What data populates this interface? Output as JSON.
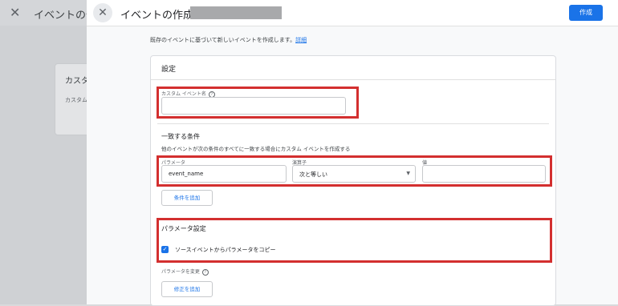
{
  "background": {
    "close_glyph": "✕",
    "title": "イベントの作",
    "card_title": "カスタム",
    "card_sub": "カスタム"
  },
  "modal": {
    "close_glyph": "✕",
    "title": "イベントの作成",
    "create_button": "作成",
    "intro_text": "既存のイベントに基づいて新しいイベントを作成します。",
    "intro_link": "詳細"
  },
  "settings": {
    "title": "設定",
    "custom_event_name_label": "カスタム イベント名",
    "custom_event_name_value": "",
    "conditions": {
      "title": "一致する条件",
      "description": "他のイベントが次の条件のすべてに一致する場合にカスタム イベントを作成する",
      "parameter_label": "パラメータ",
      "parameter_value": "event_name",
      "operator_label": "演算子",
      "operator_value": "次と等しい",
      "value_label": "値",
      "value_value": "",
      "add_condition_button": "条件を追加"
    },
    "parameter_settings": {
      "title": "パラメータ設定",
      "copy_checkbox_label": "ソースイベントからパラメータをコピー",
      "copy_checked": true
    },
    "modify_params_label": "パラメータを変更",
    "add_modification_button": "修正を追加"
  },
  "colors": {
    "accent": "#1a73e8",
    "highlight": "#d32f2f"
  }
}
